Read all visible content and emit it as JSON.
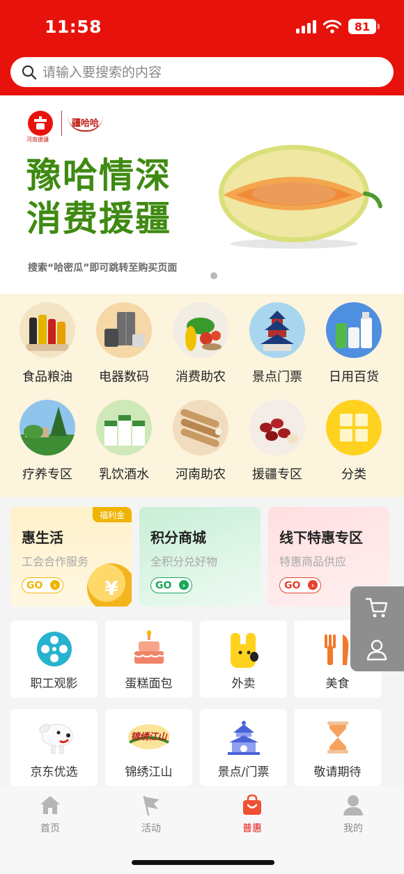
{
  "status_bar": {
    "time": "11:58",
    "battery": "81"
  },
  "search": {
    "placeholder": "请输入要搜索的内容"
  },
  "banner": {
    "logo_text": "疆哈哈",
    "logo_sub": "河南援疆",
    "slogan_line1": "豫哈情深",
    "slogan_line2": "消费援疆",
    "caption": "搜索“哈密瓜”即可跳转至购买页面"
  },
  "categories": [
    {
      "label": "食品粮油",
      "icon": "grain-oil-icon"
    },
    {
      "label": "电器数码",
      "icon": "appliance-icon"
    },
    {
      "label": "消费助农",
      "icon": "vegetables-icon"
    },
    {
      "label": "景点门票",
      "icon": "temple-icon"
    },
    {
      "label": "日用百货",
      "icon": "household-icon"
    },
    {
      "label": "疗养专区",
      "icon": "sanatorium-icon"
    },
    {
      "label": "乳饮酒水",
      "icon": "dairy-icon"
    },
    {
      "label": "河南助农",
      "icon": "yam-icon"
    },
    {
      "label": "援疆专区",
      "icon": "dates-icon"
    },
    {
      "label": "分类",
      "icon": "grid-icon"
    }
  ],
  "cards": [
    {
      "title": "惠生活",
      "subtitle": "工会合作服务",
      "go": "GO",
      "tag": "福利金",
      "color": "#f0b400"
    },
    {
      "title": "积分商城",
      "subtitle": "全积分兑好物",
      "go": "GO",
      "color": "#19a65a"
    },
    {
      "title": "线下特惠专区",
      "subtitle": "特惠商品供应",
      "go": "GO",
      "color": "#e8412c"
    }
  ],
  "services": [
    {
      "label": "职工观影",
      "icon": "film-reel-icon"
    },
    {
      "label": "蛋糕面包",
      "icon": "cake-icon"
    },
    {
      "label": "外卖",
      "icon": "takeout-icon"
    },
    {
      "label": "美食",
      "icon": "fork-knife-icon"
    },
    {
      "label": "京东优选",
      "icon": "jd-dog-icon"
    },
    {
      "label": "锦绣江山",
      "icon": "jinxiu-logo-icon",
      "logo_text": "锦绣江山"
    },
    {
      "label": "景点/门票",
      "icon": "temple-ticket-icon"
    },
    {
      "label": "敬请期待",
      "icon": "hourglass-icon"
    }
  ],
  "tabs": [
    {
      "label": "首页",
      "icon": "home-icon"
    },
    {
      "label": "活动",
      "icon": "flag-icon"
    },
    {
      "label": "普惠",
      "icon": "shopping-bag-icon",
      "active": true
    },
    {
      "label": "我的",
      "icon": "user-icon"
    }
  ],
  "colors": {
    "brand_red": "#e8120c",
    "banner_green": "#3f8a12",
    "category_bg": "#fcf4dd"
  }
}
